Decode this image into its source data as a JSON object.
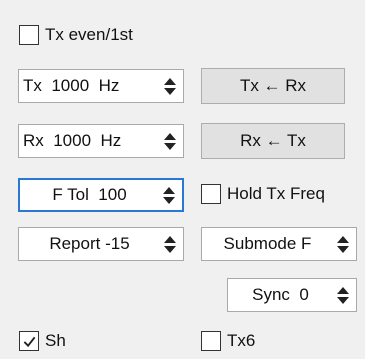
{
  "tx_even": {
    "label": "Tx even/1st",
    "checked": false
  },
  "tx_freq": {
    "value": "Tx  1000  Hz"
  },
  "tx_from_rx": {
    "label": "Tx ← Rx"
  },
  "rx_freq": {
    "value": "Rx  1000  Hz"
  },
  "rx_from_tx": {
    "label": "Rx ← Tx"
  },
  "ftol": {
    "value": "F Tol  100"
  },
  "hold_tx_freq": {
    "label": "Hold Tx Freq",
    "checked": false
  },
  "report": {
    "value": "Report -15"
  },
  "submode": {
    "value": "Submode F"
  },
  "sync": {
    "value": "Sync  0"
  },
  "sh": {
    "label": "Sh",
    "checked": true
  },
  "tx6": {
    "label": "Tx6",
    "checked": false
  }
}
